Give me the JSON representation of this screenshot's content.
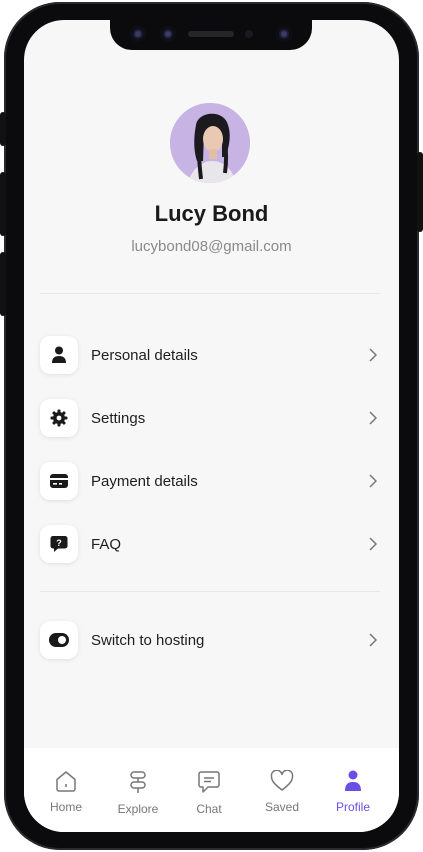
{
  "profile": {
    "name": "Lucy Bond",
    "email": "lucybond08@gmail.com"
  },
  "menu": {
    "items": [
      {
        "label": "Personal details",
        "icon": "person-icon"
      },
      {
        "label": "Settings",
        "icon": "gear-icon"
      },
      {
        "label": "Payment details",
        "icon": "credit-card-icon"
      },
      {
        "label": "FAQ",
        "icon": "question-bubble-icon"
      }
    ],
    "switch": {
      "label": "Switch to hosting",
      "icon": "toggle-icon"
    }
  },
  "tabs": [
    {
      "label": "Home",
      "icon": "home-icon"
    },
    {
      "label": "Explore",
      "icon": "signpost-icon"
    },
    {
      "label": "Chat",
      "icon": "chat-icon"
    },
    {
      "label": "Saved",
      "icon": "heart-icon"
    },
    {
      "label": "Profile",
      "icon": "person-icon",
      "active": true
    }
  ],
  "colors": {
    "accent": "#6b4ee6",
    "avatar_bg": "#c7b4e5",
    "screen_bg": "#f7f7f7"
  }
}
